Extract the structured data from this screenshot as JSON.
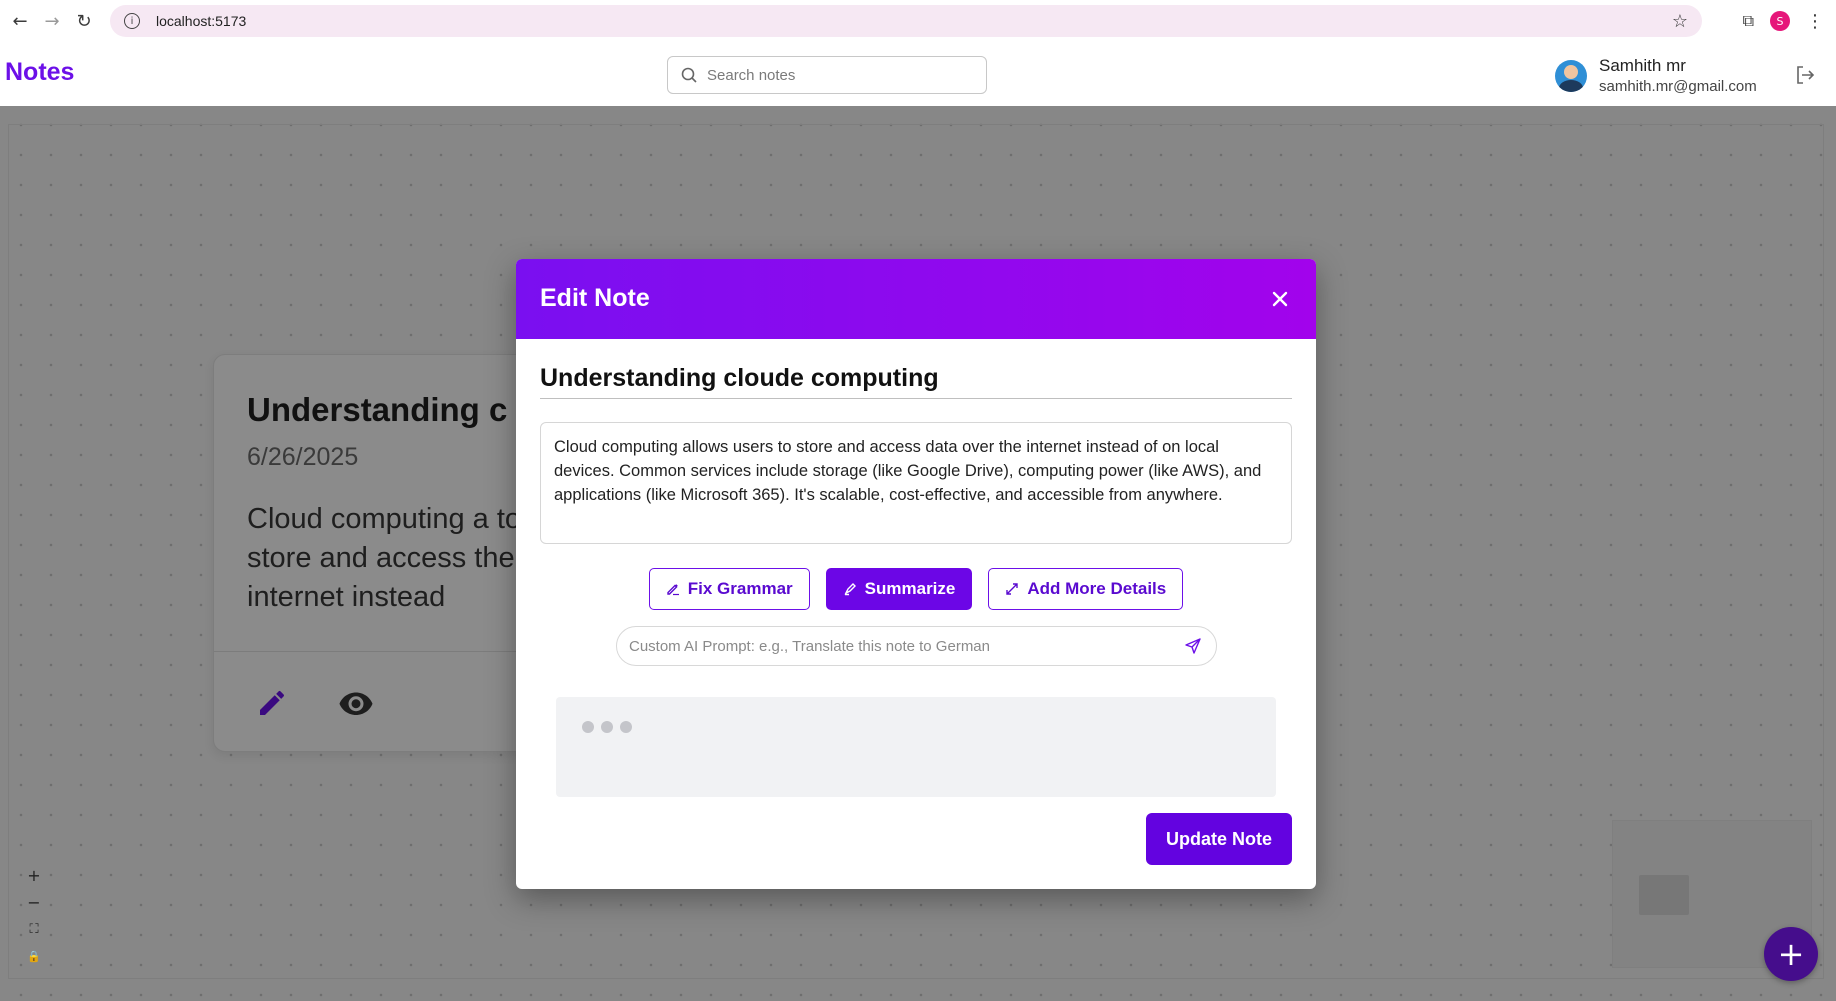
{
  "browser": {
    "url": "localhost:5173",
    "profile_initial": "S"
  },
  "header": {
    "brand": "Notes",
    "search_placeholder": "Search notes",
    "user_name": "Samhith mr",
    "user_email": "samhith.mr@gmail.com"
  },
  "note_card": {
    "title": "Understanding c",
    "date": "6/26/2025",
    "body": "Cloud computing a to store and access the internet instead"
  },
  "zoom_controls": [
    "+",
    "−",
    "⛶",
    "🔒"
  ],
  "fab_label": "+",
  "modal": {
    "title": "Edit Note",
    "note_title": "Understanding cloude computing",
    "note_body": "Cloud computing allows users to store and access data over the internet instead of on local devices. Common services include storage (like Google Drive), computing power (like AWS), and applications (like Microsoft 365). It's scalable, cost-effective, and accessible from anywhere.",
    "actions": {
      "fix_grammar": "Fix Grammar",
      "summarize": "Summarize",
      "add_details": "Add More Details"
    },
    "prompt_placeholder": "Custom AI Prompt: e.g., Translate this note to German",
    "update_button": "Update Note"
  },
  "colors": {
    "brand": "#6c10e8",
    "modal_header_start": "#7a0ff0",
    "modal_header_end": "#a203ec",
    "primary_button": "#6303e0"
  }
}
